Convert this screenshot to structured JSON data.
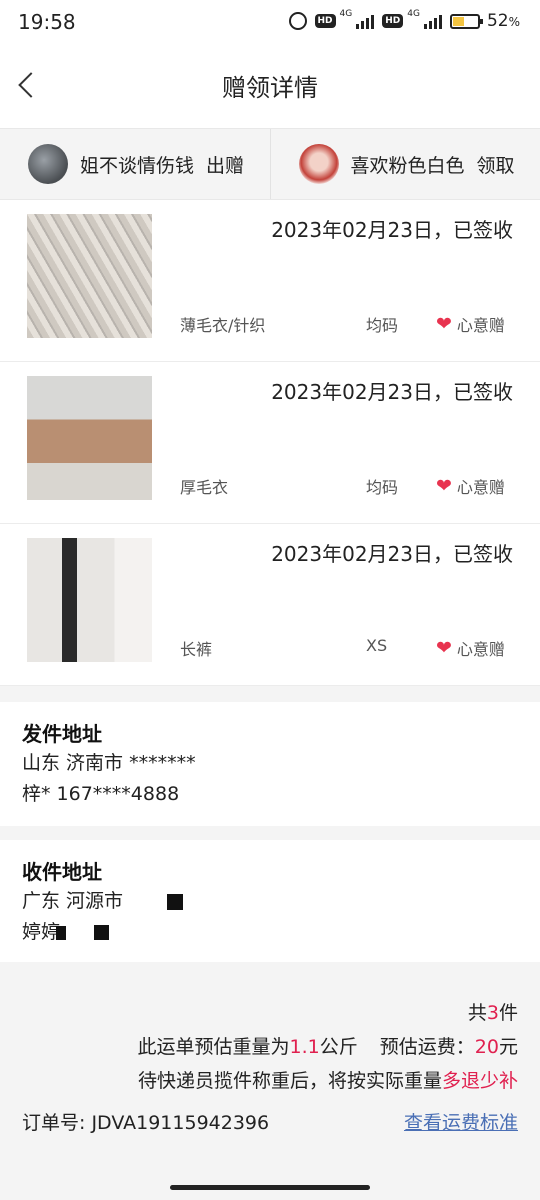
{
  "status_bar": {
    "time": "19:58",
    "hd1": "HD",
    "net1": "4G",
    "hd2": "HD",
    "net2": "4G",
    "battery_percent": "52",
    "battery_unit": "%",
    "battery_level": 0.52
  },
  "header": {
    "title": "赠领详情"
  },
  "parties": {
    "giver": {
      "name": "姐不谈情伤钱",
      "role": "出赠"
    },
    "receiver": {
      "name": "喜欢粉色白色",
      "role": "领取"
    }
  },
  "items": [
    {
      "status": "2023年02月23日，已签收",
      "name": "薄毛衣/针织",
      "size": "均码",
      "tag": "心意赠"
    },
    {
      "status": "2023年02月23日，已签收",
      "name": "厚毛衣",
      "size": "均码",
      "tag": "心意赠"
    },
    {
      "status": "2023年02月23日，已签收",
      "name": "长裤",
      "size": "XS",
      "tag": "心意赠"
    }
  ],
  "send_address": {
    "title": "发件地址",
    "region": "山东 济南市 *******",
    "contact": "梓* 167****4888"
  },
  "receive_address": {
    "title": "收件地址",
    "region": "广东 河源市",
    "contact": "婷婷"
  },
  "summary": {
    "total_prefix": "共",
    "total_count": "3",
    "total_suffix": "件",
    "weight_prefix": "此运单预估重量为",
    "weight_value": "1.1",
    "weight_unit": "公斤",
    "fee_prefix": "预估运费：",
    "fee_value": "20",
    "fee_unit": "元",
    "note_prefix": "待快递员揽件称重后，将按实际重量",
    "note_highlight": "多退少补",
    "order_label": "订单号:",
    "order_number": "JDVA19115942396",
    "fee_link": "查看运费标准"
  }
}
